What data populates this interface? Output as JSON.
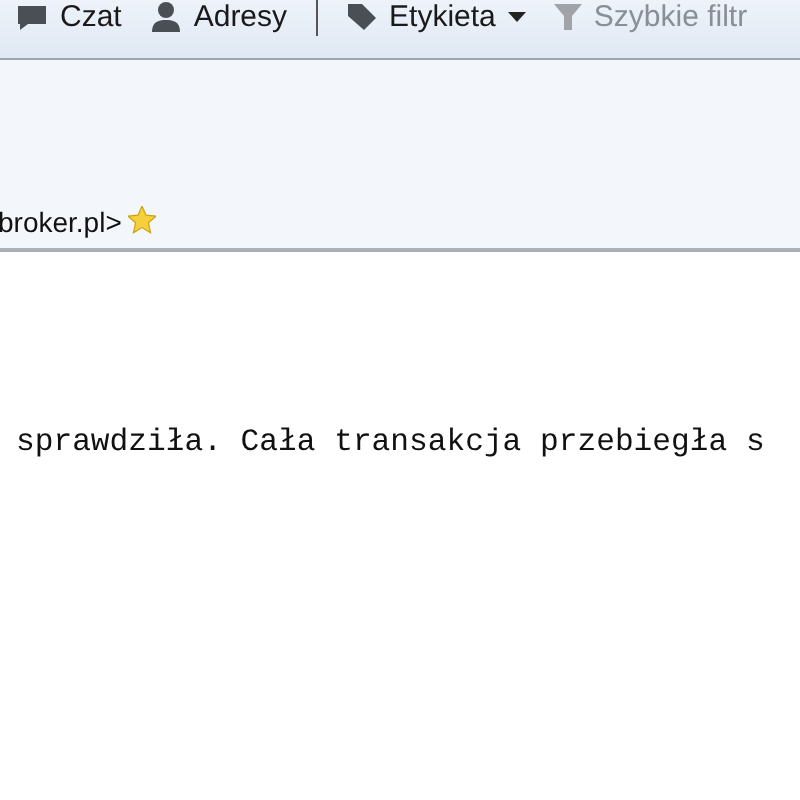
{
  "toolbar": {
    "items": [
      {
        "kind": "button",
        "label": "Czat",
        "disabled": false
      },
      {
        "kind": "button",
        "label": "Adresy",
        "disabled": false
      },
      {
        "kind": "separator"
      },
      {
        "kind": "menu",
        "label": "Etykieta",
        "disabled": false
      },
      {
        "kind": "button",
        "label": "Szybkie filtr",
        "disabled": true
      }
    ]
  },
  "header": {
    "from": "broker.pl>"
  },
  "body": {
    "lines": [
      "sprawdziła. Cała transakcja przebiegła s"
    ]
  }
}
